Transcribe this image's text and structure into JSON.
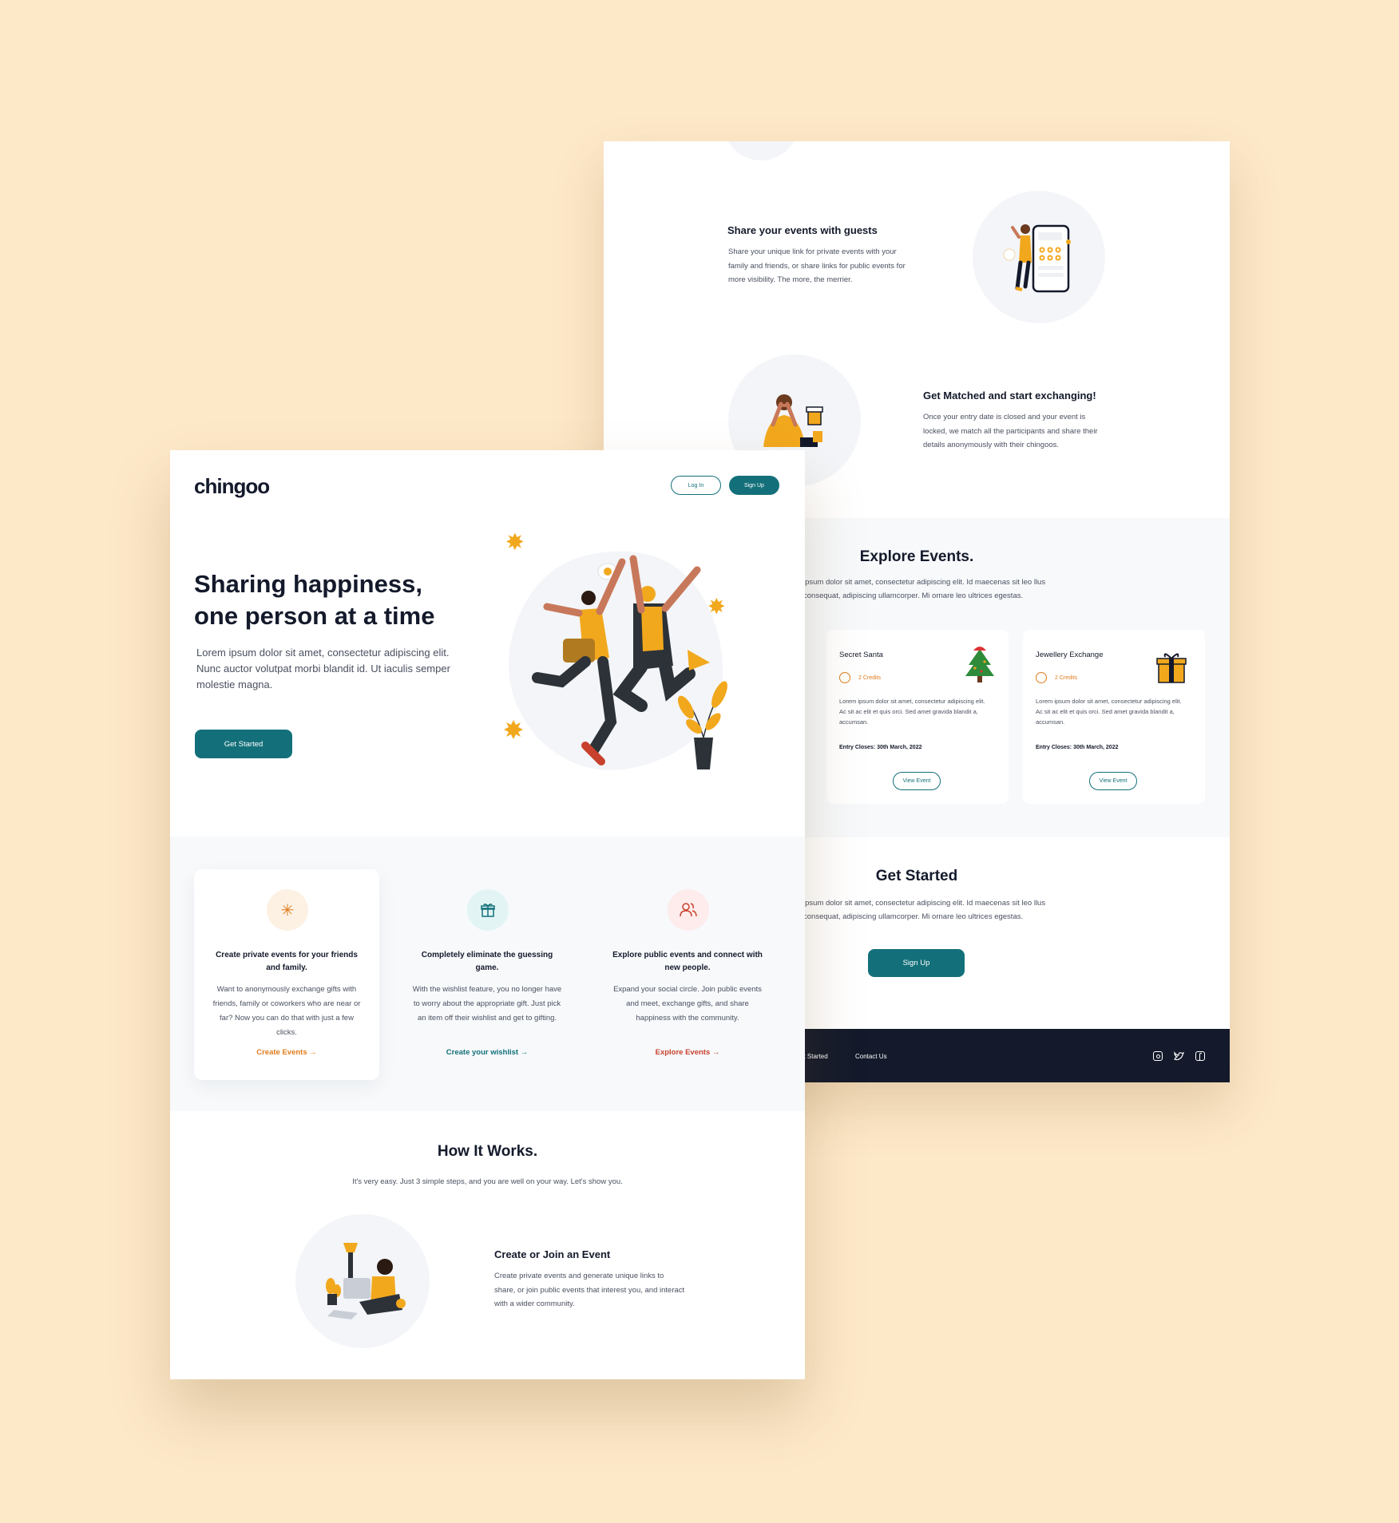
{
  "colors": {
    "accent": "#13707a",
    "orange": "#e07b1a",
    "red": "#c8412c",
    "dark": "#141a2b",
    "background": "#fde8c8"
  },
  "back": {
    "steps": [
      {
        "title": "Share your events with guests",
        "text": "Share your unique link for private events with your family and friends, or share links for public events for more visibility. The more, the merrier."
      },
      {
        "title": "Get Matched and start exchanging!",
        "text": "Once your entry date is closed and your event is locked, we match all the participants and share their details anonymously with their chingoos."
      }
    ],
    "explore": {
      "title": "Explore Events.",
      "text": "ipsum dolor sit amet, consectetur adipiscing elit. Id maecenas sit leo llus consequat, adipiscing ullamcorper. Mi ornare leo ultrices egestas.",
      "events": [
        {
          "name": "Secret Santa",
          "credits": "2 Credits",
          "desc": "Lorem ipsum dolor sit amet, consectetur adipiscing elit. Ac sit ac elit et quis orci. Sed amet gravida blandit a, accumsan.",
          "closes": "Entry Closes: 30th March, 2022",
          "button": "View Event",
          "icon": "christmas-tree-icon"
        },
        {
          "name": "Jewellery Exchange",
          "credits": "2 Credits",
          "desc": "Lorem ipsum dolor sit amet, consectetur adipiscing elit. Ac sit ac elit et quis orci. Sed amet gravida blandit a, accumsan.",
          "closes": "Entry Closes: 30th March, 2022",
          "button": "View Event",
          "icon": "gift-box-icon"
        }
      ]
    },
    "get_started": {
      "title": "Get Started",
      "text": "ipsum dolor sit amet, consectetur adipiscing elit. Id maecenas sit leo llus consequat, adipiscing ullamcorper. Mi ornare leo ultrices egestas.",
      "button": "Sign Up"
    },
    "footer": {
      "links": [
        "et Started",
        "Contact Us"
      ],
      "icons": [
        "instagram-icon",
        "twitter-icon",
        "facebook-icon"
      ]
    }
  },
  "front": {
    "logo": "chingoo",
    "nav": {
      "login": "Log In",
      "signup": "Sign Up"
    },
    "hero": {
      "title": "Sharing happiness, one person at a time",
      "text": "Lorem ipsum dolor sit amet, consectetur adipiscing elit. Nunc auctor volutpat morbi blandit id. Ut iaculis semper molestie magna.",
      "button": "Get Started"
    },
    "features": [
      {
        "icon": "snowflake-icon",
        "title": "Create private events for your friends and family.",
        "text": "Want to anonymously exchange gifts with friends, family or coworkers who are near or far? Now you can do that with just a few clicks.",
        "link": "Create Events →"
      },
      {
        "icon": "gift-icon",
        "title": "Completely eliminate the guessing game.",
        "text": "With the wishlist feature, you no longer have to worry about the appropriate gift. Just pick an item off their wishlist and get to gifting.",
        "link": "Create your wishlist →"
      },
      {
        "icon": "users-icon",
        "title": "Explore public events and connect with new people.",
        "text": "Expand your social circle. Join public events and meet, exchange gifts, and share happiness with the community.",
        "link": "Explore Events →"
      }
    ],
    "how": {
      "title": "How It Works.",
      "subtitle": "It's very easy. Just 3 simple steps, and you are well on your way. Let's show you.",
      "step": {
        "title": "Create or Join an Event",
        "text": "Create private events and generate unique links to share, or join public events that interest you, and interact with a wider community."
      }
    }
  }
}
